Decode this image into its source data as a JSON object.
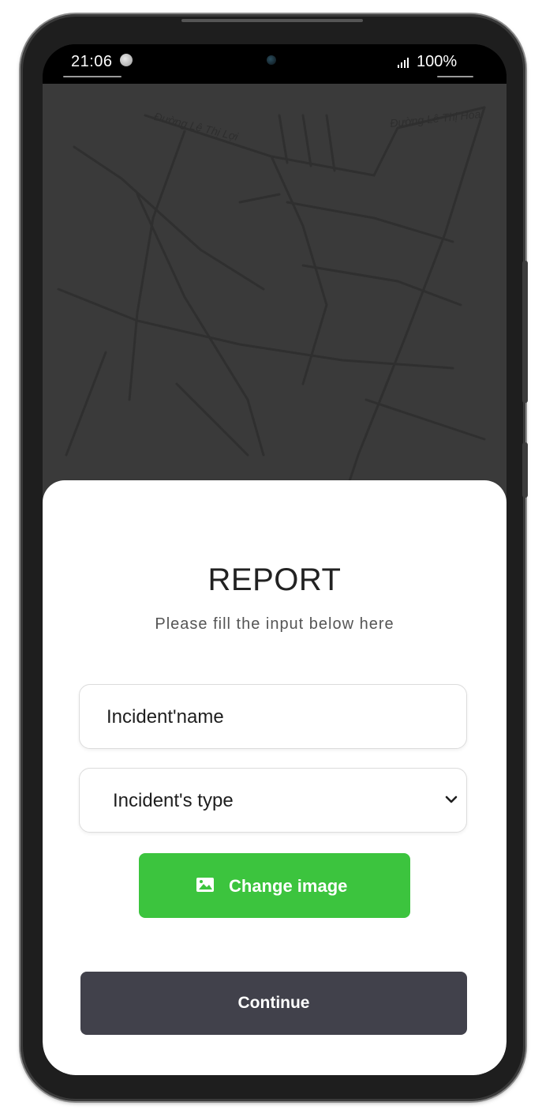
{
  "status_bar": {
    "time": "21:06",
    "battery": "100%",
    "icons": [
      "notification-dot-icon",
      "camera-icon",
      "signal-icon"
    ]
  },
  "map": {
    "labels": [
      "Đường Lê Thị Lợi",
      "Đường Lê Thị Hoa"
    ],
    "colors": {
      "background": "#3a3a3a",
      "roads": "#2f2f2f"
    }
  },
  "report": {
    "title": "REPORT",
    "subtitle": "Please fill the input below here",
    "name_field_value": "Incident'name",
    "type_select_value": "Incident's type",
    "change_image_label": "Change image",
    "continue_label": "Continue"
  },
  "colors": {
    "accent_green": "#3cc43e",
    "continue_button": "#41414b",
    "sheet": "#ffffff"
  }
}
